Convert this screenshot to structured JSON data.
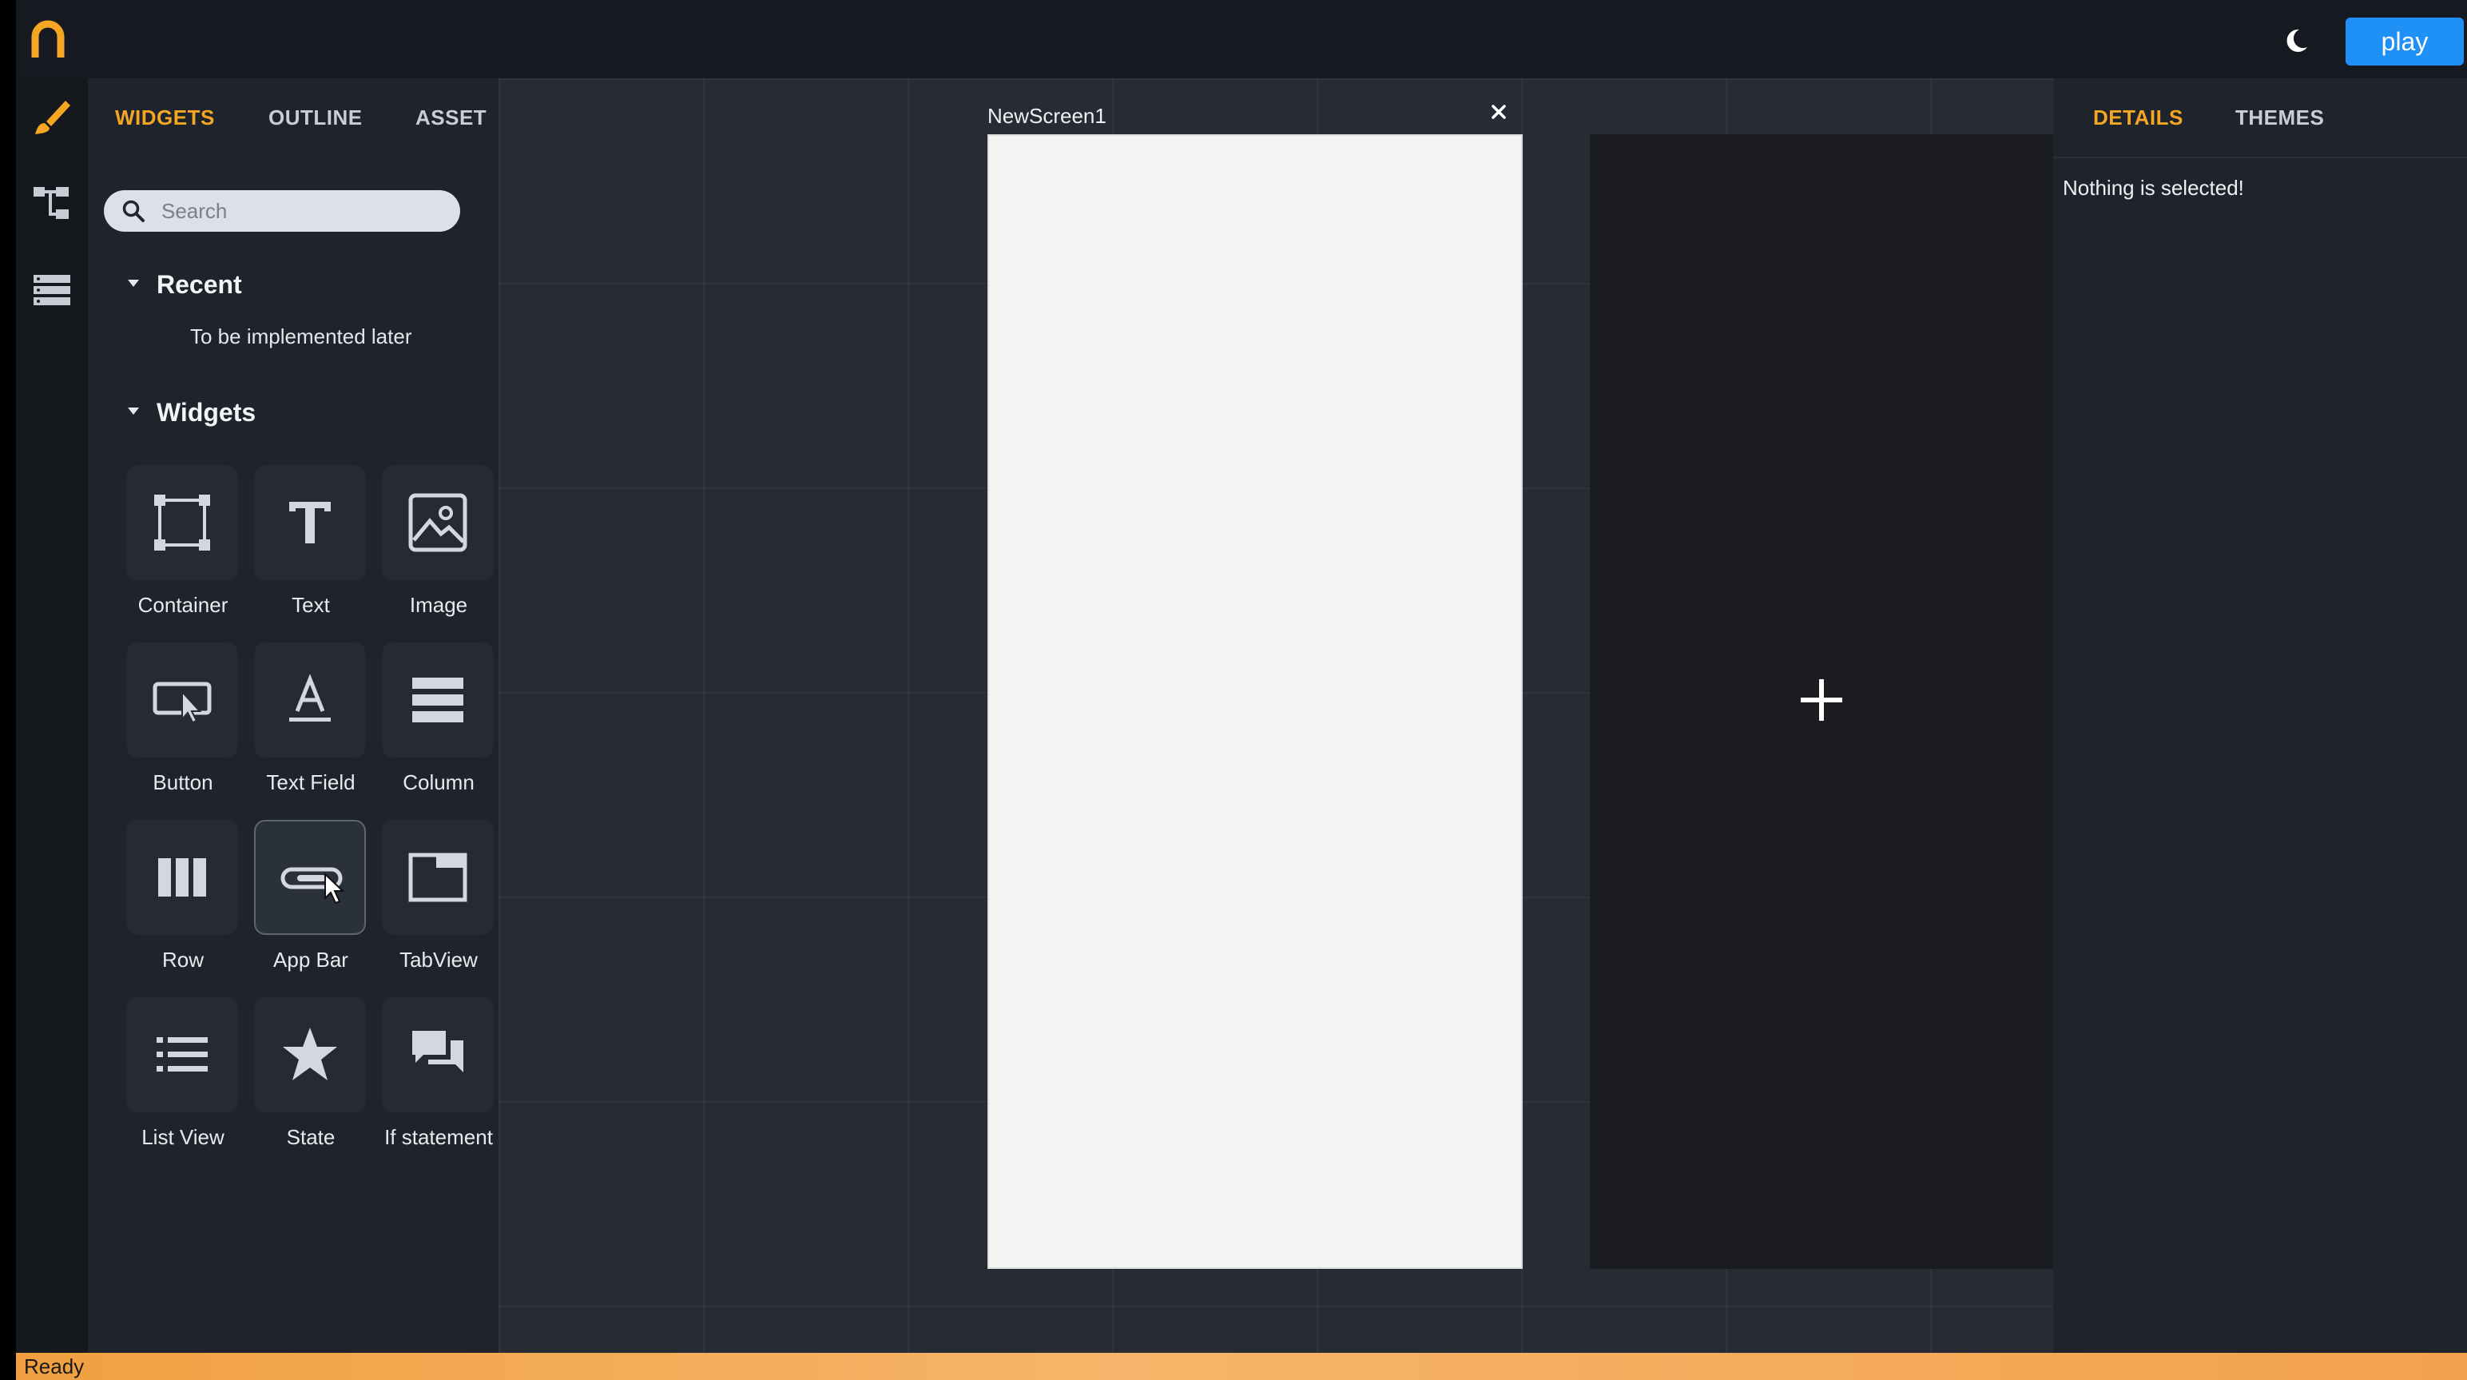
{
  "topbar": {
    "play_label": "play",
    "accent_color": "#f5a623",
    "play_color": "#1e90f6"
  },
  "rail": {
    "items": [
      {
        "icon": "brush-icon",
        "active": true
      },
      {
        "icon": "widget-tree-icon"
      },
      {
        "icon": "database-icon"
      }
    ]
  },
  "left_panel": {
    "tabs": [
      {
        "label": "WIDGETS",
        "active": true
      },
      {
        "label": "OUTLINE"
      },
      {
        "label": "ASSET"
      }
    ],
    "search": {
      "placeholder": "Search",
      "value": ""
    },
    "recent": {
      "title": "Recent",
      "note": "To be implemented later"
    },
    "widgets": {
      "title": "Widgets",
      "items": [
        {
          "label": "Container",
          "icon": "container-icon"
        },
        {
          "label": "Text",
          "icon": "text-icon"
        },
        {
          "label": "Image",
          "icon": "image-icon"
        },
        {
          "label": "Button",
          "icon": "button-icon"
        },
        {
          "label": "Text Field",
          "icon": "text-field-icon"
        },
        {
          "label": "Column",
          "icon": "column-icon"
        },
        {
          "label": "Row",
          "icon": "row-icon"
        },
        {
          "label": "App Bar",
          "icon": "app-bar-icon",
          "hovered": true
        },
        {
          "label": "TabView",
          "icon": "tabview-icon"
        },
        {
          "label": "List View",
          "icon": "list-view-icon"
        },
        {
          "label": "State",
          "icon": "star-icon"
        },
        {
          "label": "If statement",
          "icon": "chat-icon"
        }
      ]
    }
  },
  "canvas": {
    "screen_title": "NewScreen1",
    "close_glyph": "×"
  },
  "right_panel": {
    "tabs": [
      {
        "label": "DETAILS",
        "active": true
      },
      {
        "label": "THEMES"
      }
    ],
    "empty_message": "Nothing is selected!"
  },
  "status_bar": {
    "text": "Ready"
  }
}
